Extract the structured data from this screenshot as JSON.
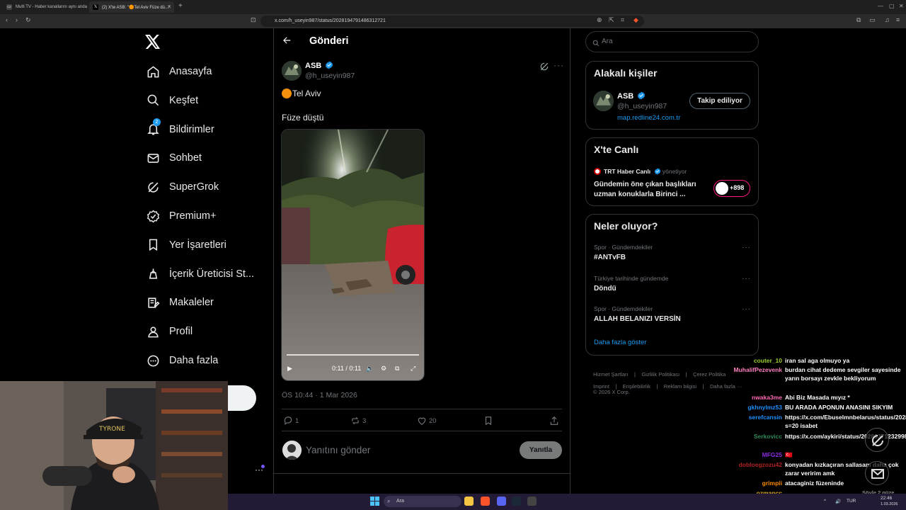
{
  "browser": {
    "tabs": [
      {
        "title": "Multi TV - Haber kanallarını aynı anda"
      },
      {
        "title": "(2) X'te ASB: \"🟠Tel Aviv Füze dü...\""
      }
    ],
    "url": "x.com/h_useyin987/status/2028194791486312721"
  },
  "nav": {
    "items": [
      {
        "label": "Anasayfa",
        "icon": "home-icon"
      },
      {
        "label": "Keşfet",
        "icon": "search-icon"
      },
      {
        "label": "Bildirimler",
        "icon": "bell-icon",
        "badge": "2"
      },
      {
        "label": "Sohbet",
        "icon": "mail-icon"
      },
      {
        "label": "SuperGrok",
        "icon": "grok-icon"
      },
      {
        "label": "Premium+",
        "icon": "verified-badge-icon"
      },
      {
        "label": "Yer İşaretleri",
        "icon": "bookmark-icon"
      },
      {
        "label": "İçerik Üreticisi St...",
        "icon": "creator-studio-icon"
      },
      {
        "label": "Makaleler",
        "icon": "article-icon"
      },
      {
        "label": "Profil",
        "icon": "person-icon"
      },
      {
        "label": "Daha fazla",
        "icon": "more-circle-icon"
      }
    ]
  },
  "post": {
    "header_title": "Gönderi",
    "author_name": "ASB",
    "author_handle": "@h_useyin987",
    "line1": "Tel Aviv",
    "line2": "Füze düştü",
    "video_time": "0:11 / 0:11",
    "timestamp": "ÖS 10:44 · 1 Mar 2026",
    "stats": {
      "replies": "1",
      "reposts": "3",
      "likes": "20"
    },
    "reply_placeholder": "Yanıtını gönder",
    "reply_button": "Yanıtla"
  },
  "sidebar": {
    "search_placeholder": "Ara",
    "relevant_title": "Alakalı kişiler",
    "relevant_person": {
      "name": "ASB",
      "handle": "@h_useyin987",
      "link": "map.redline24.com.tr",
      "follow_label": "Takip ediliyor"
    },
    "live_title": "X'te Canlı",
    "live": {
      "host": "TRT Haber Canlı",
      "role": "yönetiyor",
      "text": "Gündemin öne çıkan başlıkları uzman konuklarla Birinci ...",
      "count": "+898"
    },
    "trends_title": "Neler oluyor?",
    "trends": [
      {
        "meta": "Spor · Gündemdekiler",
        "name": "#ANTvFB"
      },
      {
        "meta": "Türkiye tarihinde gündemde",
        "name": "Döndü"
      },
      {
        "meta": "Spor · Gündemdekiler",
        "name": "ALLAH BELANIZI VERSİN"
      }
    ],
    "show_more": "Daha fazla göster",
    "footer_row1": [
      "Hizmet Şartları",
      "Gizlilik Politikası",
      "Çerez Politika"
    ],
    "footer_row2": [
      "Imprint",
      "Erişilebilirlik",
      "Reklam bilgisi",
      "Daha fazla ···"
    ],
    "copyright": "© 2026 X Corp."
  },
  "chat": [
    {
      "user": "couter_10",
      "color": "#9acd32",
      "msg": "iran sal aga olmuyo ya"
    },
    {
      "user": "MuhalifPezevenk",
      "color": "#ff7fbf",
      "msg": "burdan cihat dedeme sevgiler sayesinde yarın borsayı zevkle bekliyorum"
    },
    {
      "user": "nwaka3me",
      "color": "#ff69b4",
      "msg": "Abi Biz Masada mıyız *"
    },
    {
      "user": "gkhnylmz53",
      "color": "#1e90ff",
      "msg": "BU ARADA APONUN ANASINI SIKYIM"
    },
    {
      "user": "serefcansin",
      "color": "#1e90ff",
      "msg": "https://x.com/Ebuselmnbelarus/status/2028194520580731349?s=20 isabet"
    },
    {
      "user": "Serkovicc",
      "color": "#2e8b57",
      "msg": "https://x.com/aykiri/status/2028037123299823756"
    },
    {
      "user": "MFG25",
      "color": "#8a2be2",
      "msg": "🇹🇷"
    },
    {
      "user": "dobloegzozu42",
      "color": "#b22222",
      "msg": "konyadan kızkaçıran sallasam daha çok zarar veririm amk"
    },
    {
      "user": "grimpii",
      "color": "#ff8c00",
      "msg": "atacaginiz füzeninde"
    },
    {
      "user": "ozmancc",
      "color": "#daa520",
      "msg": ""
    }
  ],
  "taskbar": {
    "search_placeholder": "Ara",
    "lang": "TUR",
    "time": "22:46",
    "date": "1.03.2026",
    "overlay_text": "Söyle 2 güze"
  }
}
